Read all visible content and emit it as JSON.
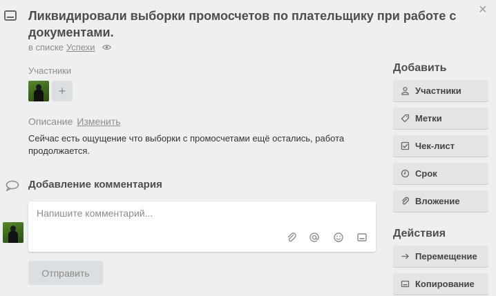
{
  "card": {
    "title": "Ликвидировали выборки промосчетов по плательщику при работе с документами.",
    "in_list_prefix": "в списке",
    "list_name": "Успехи",
    "close_glyph": "×"
  },
  "members": {
    "label": "Участники",
    "add_glyph": "+"
  },
  "description": {
    "label": "Описание",
    "edit_link": "Изменить",
    "text": "Сейчас есть ощущение что выборки с промосчетами ещё остались, работа продолжается."
  },
  "comment": {
    "heading": "Добавление комментария",
    "placeholder": "Напишите комментарий...",
    "send_label": "Отправить",
    "tools": [
      "paperclip-icon",
      "at-icon",
      "emoji-icon",
      "card-icon"
    ]
  },
  "sidebar": {
    "add_heading": "Добавить",
    "add_items": [
      {
        "label": "Участники",
        "icon": "person-icon"
      },
      {
        "label": "Метки",
        "icon": "tag-icon"
      },
      {
        "label": "Чек-лист",
        "icon": "checklist-icon"
      },
      {
        "label": "Срок",
        "icon": "clock-icon"
      },
      {
        "label": "Вложение",
        "icon": "paperclip-icon"
      }
    ],
    "actions_heading": "Действия",
    "action_items": [
      {
        "label": "Перемещение",
        "icon": "arrow-right-icon"
      },
      {
        "label": "Копирование",
        "icon": "card-icon"
      }
    ]
  }
}
